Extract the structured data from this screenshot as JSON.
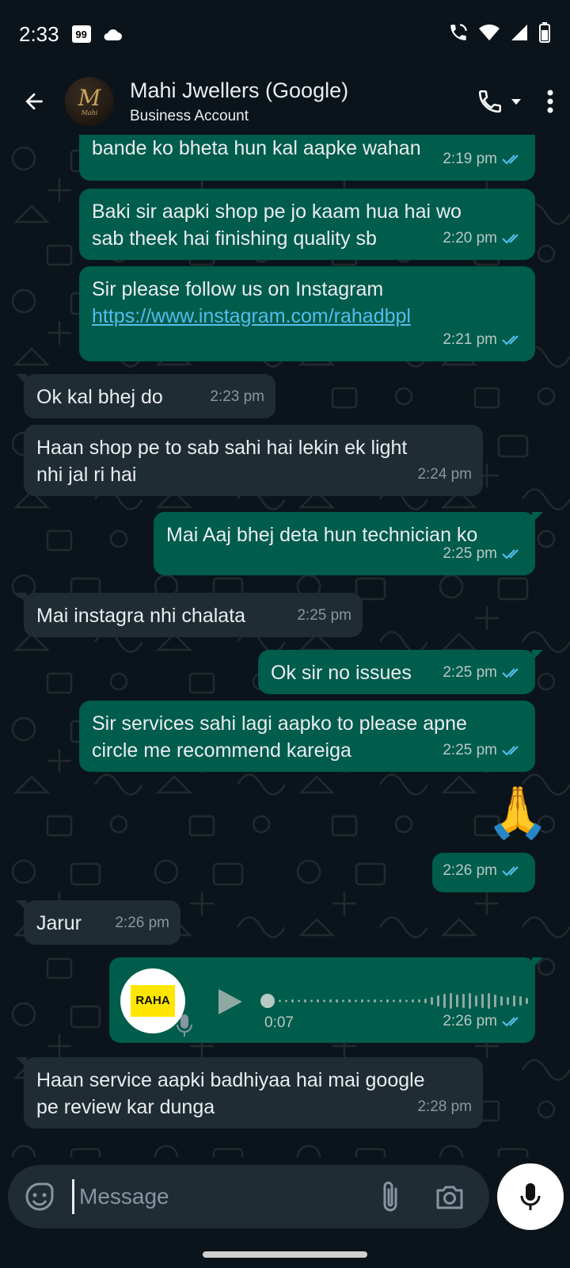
{
  "status_bar": {
    "time": "2:33",
    "badge": "99"
  },
  "header": {
    "contact_name": "Mahi Jwellers (Google)",
    "subtitle": "Business Account",
    "avatar_text": "M",
    "avatar_subtext": "Mahi"
  },
  "messages": [
    {
      "dir": "out",
      "text": "bande ko bheta hun kal aapke wahan",
      "time": "2:19 pm",
      "status": "read"
    },
    {
      "dir": "out",
      "line1": "Baki sir aapki shop pe jo kaam hua hai wo",
      "line2": "sab theek hai finishing quality sb",
      "time": "2:20 pm",
      "status": "read"
    },
    {
      "dir": "out",
      "line1": "Sir please follow us on Instagram",
      "link": "https://www.instagram.com/rahadbpl",
      "time": "2:21 pm",
      "status": "read"
    },
    {
      "dir": "in",
      "text": "Ok kal bhej do",
      "time": "2:23 pm"
    },
    {
      "dir": "in",
      "line1": "Haan shop pe to sab sahi hai lekin ek light",
      "line2": "nhi jal ri hai",
      "time": "2:24 pm"
    },
    {
      "dir": "out",
      "text": "Mai Aaj bhej deta hun technician ko",
      "time": "2:25 pm",
      "status": "read"
    },
    {
      "dir": "in",
      "text": "Mai instagra nhi chalata",
      "time": "2:25 pm"
    },
    {
      "dir": "out",
      "text": "Ok sir no issues",
      "time": "2:25 pm",
      "status": "read"
    },
    {
      "dir": "out",
      "line1": "Sir services sahi lagi aapko to please apne",
      "line2": "circle me recommend kareiga",
      "time": "2:25 pm",
      "status": "read"
    },
    {
      "dir": "out",
      "emoji": "🙏",
      "time": "2:26 pm",
      "status": "read"
    },
    {
      "dir": "in",
      "text": "Jarur",
      "time": "2:26 pm"
    },
    {
      "dir": "out",
      "type": "voice",
      "avatar_label": "RAHA",
      "duration": "0:07",
      "time": "2:26 pm",
      "status": "read"
    },
    {
      "dir": "in",
      "line1": "Haan service aapki badhiyaa hai mai google",
      "line2": "pe review kar dunga",
      "time": "2:28 pm"
    }
  ],
  "composer": {
    "placeholder": "Message"
  },
  "colors": {
    "outgoing": "#005c4b",
    "incoming": "#202c33",
    "background": "#0b141a",
    "read_ticks": "#53bdeb"
  },
  "icons": [
    "back-arrow-icon",
    "call-icon",
    "dropdown-icon",
    "more-icon",
    "sticker-icon",
    "attach-icon",
    "camera-icon",
    "mic-icon",
    "play-icon"
  ]
}
